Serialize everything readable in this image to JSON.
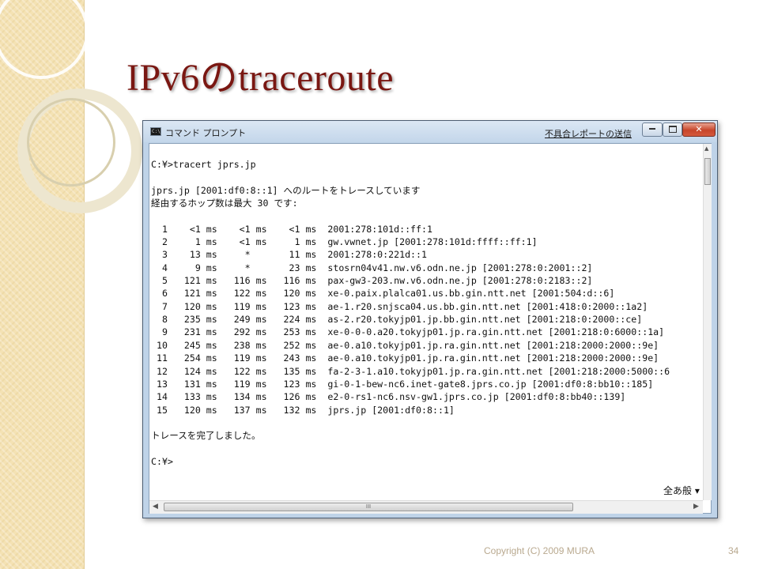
{
  "slide": {
    "title": "IPv6のtraceroute",
    "copyright": "Copyright (C) 2009 MURA",
    "page_number": "34"
  },
  "window": {
    "title": "コマンド プロンプト",
    "icon": "cmd-icon",
    "report_link": "不具合レポートの送信",
    "controls": {
      "minimize": "minimize-icon",
      "maximize": "maximize-icon",
      "close": "close-icon"
    }
  },
  "console": {
    "lines": [
      "C:¥>tracert jprs.jp",
      "",
      "jprs.jp [2001:df0:8::1] へのルートをトレースしています",
      "経由するホップ数は最大 30 です:",
      "",
      "  1    <1 ms    <1 ms    <1 ms  2001:278:101d::ff:1",
      "  2     1 ms    <1 ms     1 ms  gw.vwnet.jp [2001:278:101d:ffff::ff:1]",
      "  3    13 ms     *       11 ms  2001:278:0:221d::1",
      "  4     9 ms     *       23 ms  stosrn04v41.nw.v6.odn.ne.jp [2001:278:0:2001::2]",
      "  5   121 ms   116 ms   116 ms  pax-gw3-203.nw.v6.odn.ne.jp [2001:278:0:2183::2]",
      "  6   121 ms   122 ms   120 ms  xe-0.paix.plalca01.us.bb.gin.ntt.net [2001:504:d::6]",
      "  7   120 ms   119 ms   123 ms  ae-1.r20.snjsca04.us.bb.gin.ntt.net [2001:418:0:2000::1a2]",
      "  8   235 ms   249 ms   224 ms  as-2.r20.tokyjp01.jp.bb.gin.ntt.net [2001:218:0:2000::ce]",
      "  9   231 ms   292 ms   253 ms  xe-0-0-0.a20.tokyjp01.jp.ra.gin.ntt.net [2001:218:0:6000::1a]",
      " 10   245 ms   238 ms   252 ms  ae-0.a10.tokyjp01.jp.ra.gin.ntt.net [2001:218:2000:2000::9e]",
      " 11   254 ms   119 ms   243 ms  ae-0.a10.tokyjp01.jp.ra.gin.ntt.net [2001:218:2000:2000::9e]",
      " 12   124 ms   122 ms   135 ms  fa-2-3-1.a10.tokyjp01.jp.ra.gin.ntt.net [2001:218:2000:5000::6",
      " 13   131 ms   119 ms   123 ms  gi-0-1-bew-nc6.inet-gate8.jprs.co.jp [2001:df0:8:bb10::185]",
      " 14   133 ms   134 ms   126 ms  e2-0-rs1-nc6.nsv-gw1.jprs.co.jp [2001:df0:8:bb40::139]",
      " 15   120 ms   137 ms   132 ms  jprs.jp [2001:df0:8::1]",
      "",
      "トレースを完了しました。",
      "",
      "C:¥>"
    ],
    "ime_indicator": "全あ般",
    "hscroll_grip": "III"
  }
}
